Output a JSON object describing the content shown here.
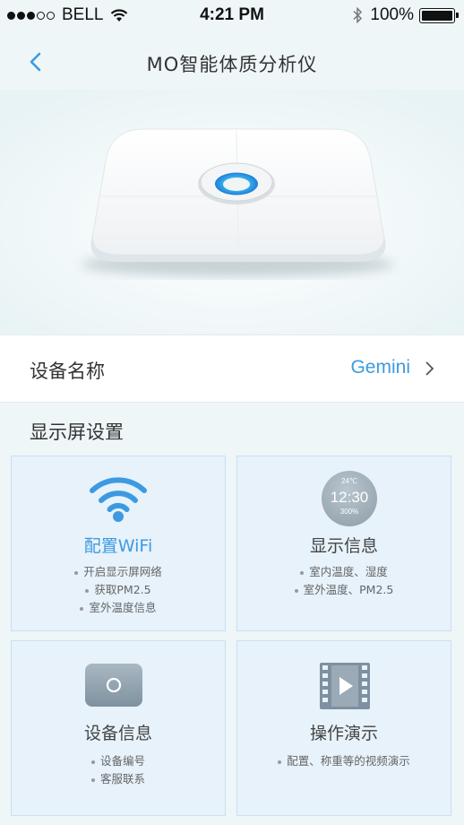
{
  "status_bar": {
    "carrier": "BELL",
    "time": "4:21 PM",
    "battery": "100%"
  },
  "navbar": {
    "title": "MO智能体质分析仪",
    "back_icon": "chevron-left-icon"
  },
  "device_name": {
    "label": "设备名称",
    "value": "Gemini"
  },
  "section_title": "显示屏设置",
  "cards": [
    {
      "title": "配置WiFi",
      "icon": "wifi-icon",
      "lines": [
        "开启显示屏网络",
        "获取PM2.5",
        "室外温度信息"
      ]
    },
    {
      "title": "显示信息",
      "icon": "clock-display-icon",
      "clock": {
        "temp": "24℃",
        "time": "12:30",
        "humidity": "300%"
      },
      "lines": [
        "室内温度、湿度",
        "室外温度、PM2.5"
      ]
    },
    {
      "title": "设备信息",
      "icon": "device-info-icon",
      "lines": [
        "设备编号",
        "客服联系"
      ]
    },
    {
      "title": "操作演示",
      "icon": "video-icon",
      "lines": [
        "配置、称重等的视频演示"
      ]
    }
  ],
  "colors": {
    "accent": "#3d9ae0",
    "background": "#eef6f8",
    "card_bg": "#e7f2fb",
    "card_border": "#c9dff0"
  }
}
